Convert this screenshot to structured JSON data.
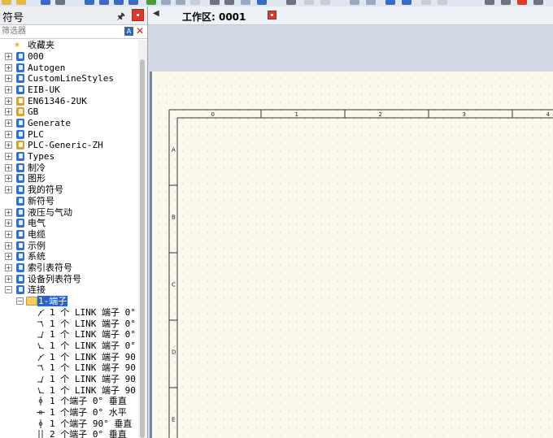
{
  "panel": {
    "title": "符号",
    "filter_placeholder": "筛选器",
    "filter_value": ""
  },
  "tree": {
    "favorites": "收藏夹",
    "items": [
      {
        "label": "000"
      },
      {
        "label": "Autogen"
      },
      {
        "label": "CustomLineStyles"
      },
      {
        "label": "EIB-UK"
      },
      {
        "label": "EN61346-2UK"
      },
      {
        "label": "GB"
      },
      {
        "label": "Generate"
      },
      {
        "label": "PLC"
      },
      {
        "label": "PLC-Generic-ZH"
      },
      {
        "label": "Types"
      },
      {
        "label": "制冷"
      },
      {
        "label": "图形"
      },
      {
        "label": "我的符号"
      },
      {
        "label": "新符号"
      },
      {
        "label": "液压与气动"
      },
      {
        "label": "电气"
      },
      {
        "label": "电缆"
      },
      {
        "label": "示例"
      },
      {
        "label": "系统"
      },
      {
        "label": "索引表符号"
      },
      {
        "label": "设备列表符号"
      },
      {
        "label": "连接"
      }
    ],
    "open_folder": "1-端子",
    "symbols": [
      {
        "label": "1 个 LINK 端子 0°"
      },
      {
        "label": "1 个 LINK 端子 0°"
      },
      {
        "label": "1 个 LINK 端子 0°"
      },
      {
        "label": "1 个 LINK 端子 0°"
      },
      {
        "label": "1 个 LINK 端子 90"
      },
      {
        "label": "1 个 LINK 端子 90"
      },
      {
        "label": "1 个 LINK 端子 90"
      },
      {
        "label": "1 个 LINK 端子 90"
      },
      {
        "label": "1 个端子 0° 垂直"
      },
      {
        "label": "1 个端子 0° 水平"
      },
      {
        "label": "1 个端子 90° 垂直"
      },
      {
        "label": "2 个端子 0° 垂直"
      }
    ]
  },
  "workspace": {
    "tab_label": "工作区: 0001"
  },
  "sheet": {
    "columns": [
      "0",
      "1",
      "2",
      "3",
      "4"
    ],
    "rows": [
      "A",
      "B",
      "C",
      "D",
      "E"
    ]
  },
  "colors": {
    "selection": "#2a63c8",
    "canvas": "#fbf8ec",
    "workspace_bg": "#d3d9e4"
  }
}
